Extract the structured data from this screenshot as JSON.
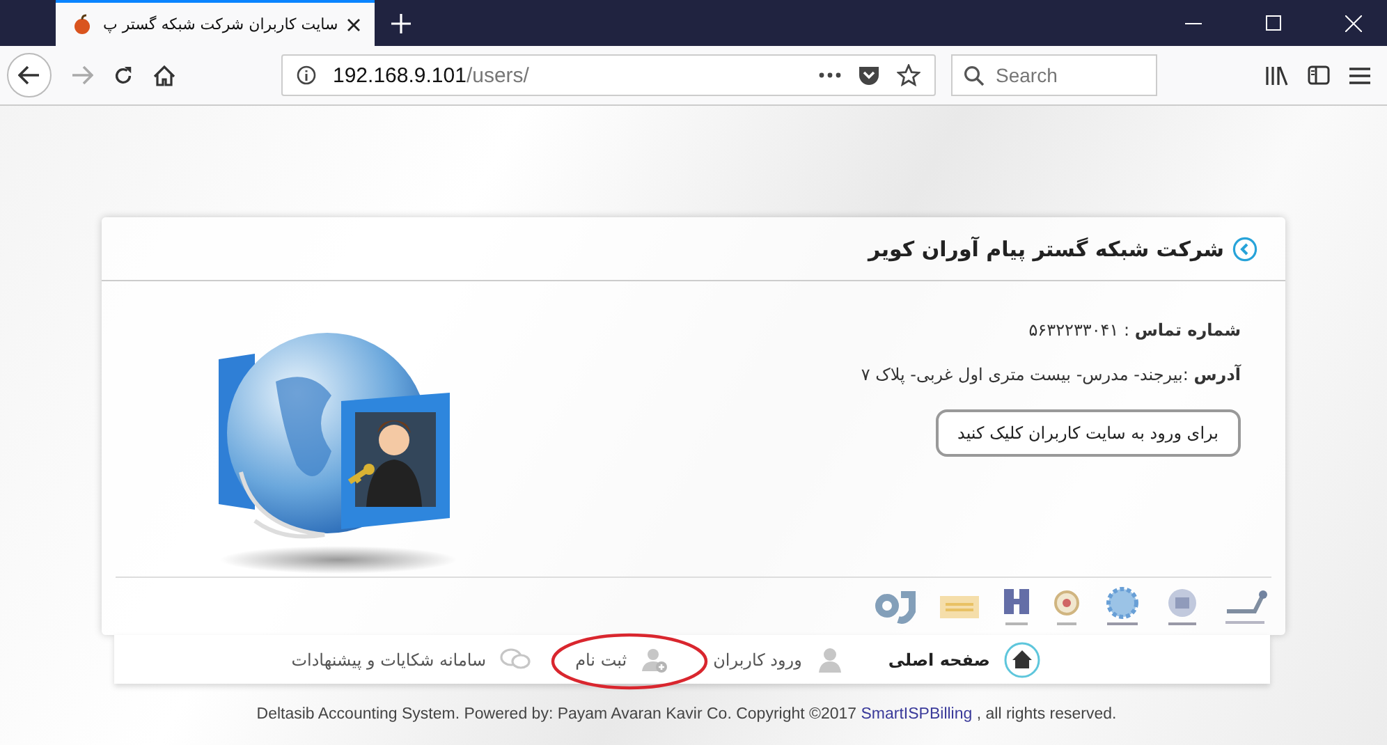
{
  "browser": {
    "tab_title": "سایت کاربران شرکت شبکه گستر پ",
    "url_host": "192.168.9.101",
    "url_path": "/users/",
    "search_placeholder": "Search"
  },
  "card": {
    "title": "شرکت شبکه گستر پیام آوران کویر",
    "phone": "**شماره تماس** : ۵۶۳۲۲۳۳۰۴۱",
    "address": "**آدرس** :بیرجند- مدرس- بیست متری اول غربی- پلاک ۷",
    "login_button": "برای ورود به سایت کاربران کلیک کنید"
  },
  "nav": [
    {
      "label": "صفحه اصلی",
      "kind": "home",
      "selected": true,
      "circled": false
    },
    {
      "label": "ورود کاربران",
      "kind": "user",
      "selected": false,
      "circled": false
    },
    {
      "label": "ثبت نام",
      "kind": "add-user",
      "selected": false,
      "circled": true
    },
    {
      "label": "سامانه شکایات و پیشنهادات",
      "kind": "chat",
      "selected": false,
      "circled": false
    }
  ],
  "footer": {
    "before": "Deltasib Accounting System. Powered by: Payam Avaran Kavir Co. Copyright ©2017",
    "link": "SmartISPBilling",
    "after": ", all rights reserved."
  }
}
